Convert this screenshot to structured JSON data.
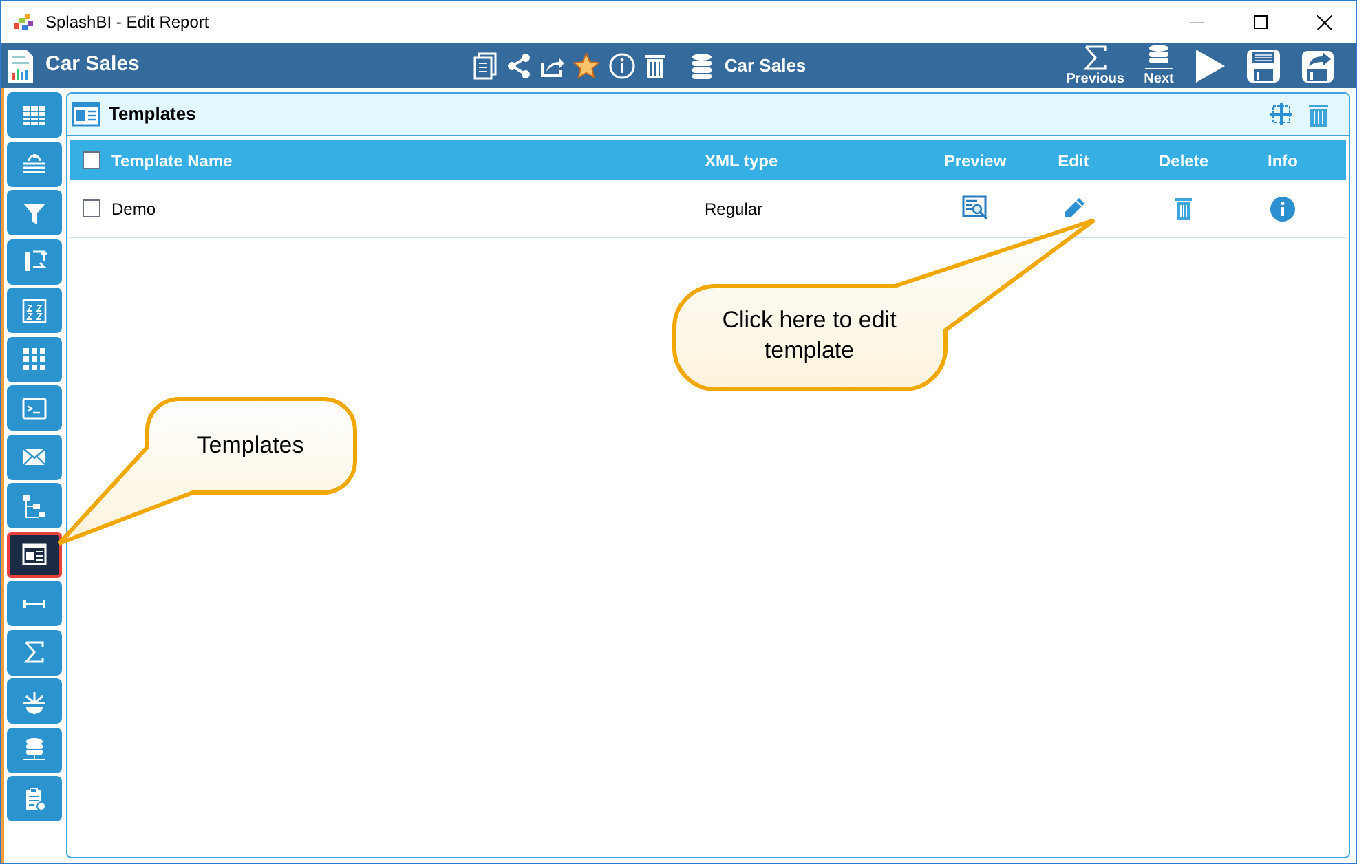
{
  "window": {
    "title": "SplashBI - Edit Report"
  },
  "header": {
    "title": "Car Sales",
    "datasource": "Car Sales",
    "nav": [
      {
        "label": "Previous"
      },
      {
        "label": "Next"
      }
    ]
  },
  "sidebar": {
    "items": [
      {
        "selected": false
      },
      {
        "selected": false
      },
      {
        "selected": false
      },
      {
        "selected": false
      },
      {
        "selected": false
      },
      {
        "selected": false
      },
      {
        "selected": false
      },
      {
        "selected": false
      },
      {
        "selected": false
      },
      {
        "selected": true
      },
      {
        "selected": false
      },
      {
        "selected": false
      },
      {
        "selected": false
      },
      {
        "selected": false
      },
      {
        "selected": false
      }
    ]
  },
  "panel": {
    "title": "Templates"
  },
  "table": {
    "select_all_checked": false,
    "columns": [
      "Template Name",
      "XML type",
      "Preview",
      "Edit",
      "Delete",
      "Info"
    ],
    "rows": [
      {
        "name": "Demo",
        "xml_type": "Regular",
        "checked": false
      }
    ]
  },
  "callouts": [
    {
      "text": "Templates"
    },
    {
      "text": "Click here to edit template"
    }
  ]
}
